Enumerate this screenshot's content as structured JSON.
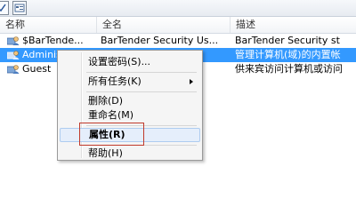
{
  "columns": {
    "name": "名称",
    "fullname": "全名",
    "description": "描述"
  },
  "rows": [
    {
      "name": "$BarTende...",
      "fullname": "BarTender Security Us...",
      "description": "BarTender Security st"
    },
    {
      "name": "Administ...",
      "fullname": "",
      "description": "管理计算机(域)的内置帐"
    },
    {
      "name": "Guest",
      "fullname": "",
      "description": "供来宾访问计算机或访问"
    }
  ],
  "context_menu": {
    "set_password": "设置密码(S)...",
    "all_tasks": "所有任务(K)",
    "delete": "删除(D)",
    "rename": "重命名(M)",
    "properties": "属性(R)",
    "help": "帮助(H)"
  },
  "colors": {
    "selection": "#3399ff",
    "highlight_box": "#c0392b"
  },
  "icons": [
    "toolbar-icon",
    "properties-view-icon",
    "user-icon",
    "submenu-arrow-icon"
  ]
}
